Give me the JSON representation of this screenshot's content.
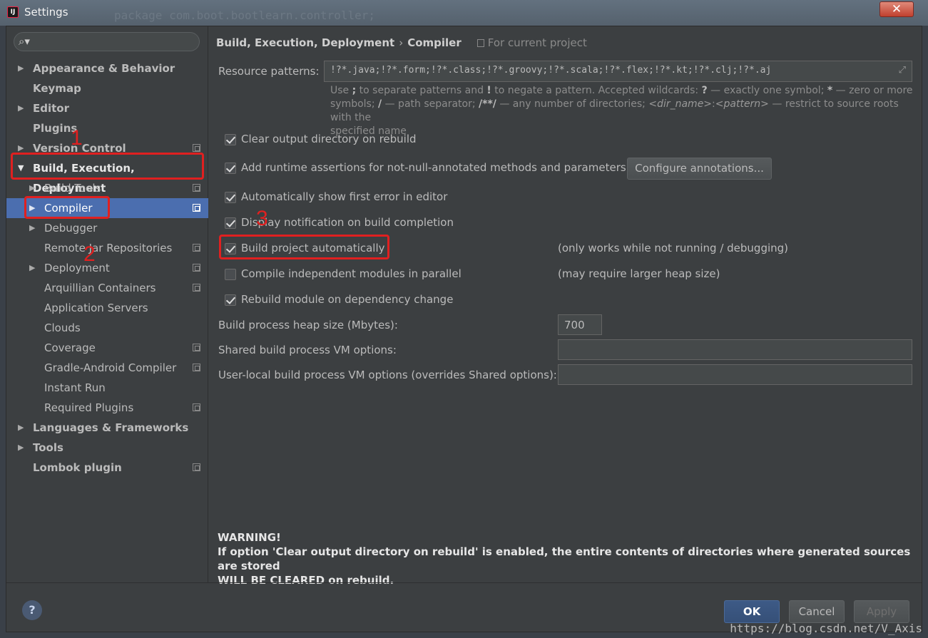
{
  "window": {
    "title": "Settings",
    "background_code": "package com.boot.bootlearn.controller;"
  },
  "search": {
    "placeholder": ""
  },
  "sidebar": {
    "items": [
      {
        "label": "Appearance & Behavior"
      },
      {
        "label": "Keymap"
      },
      {
        "label": "Editor"
      },
      {
        "label": "Plugins"
      },
      {
        "label": "Version Control"
      },
      {
        "label": "Build, Execution, Deployment"
      },
      {
        "label": "Build Tools"
      },
      {
        "label": "Compiler"
      },
      {
        "label": "Debugger"
      },
      {
        "label": "Remote Jar Repositories"
      },
      {
        "label": "Deployment"
      },
      {
        "label": "Arquillian Containers"
      },
      {
        "label": "Application Servers"
      },
      {
        "label": "Clouds"
      },
      {
        "label": "Coverage"
      },
      {
        "label": "Gradle-Android Compiler"
      },
      {
        "label": "Instant Run"
      },
      {
        "label": "Required Plugins"
      },
      {
        "label": "Languages & Frameworks"
      },
      {
        "label": "Tools"
      },
      {
        "label": "Lombok plugin"
      }
    ]
  },
  "annotations": {
    "n1": "1",
    "n2": "2",
    "n3": "3"
  },
  "breadcrumb": {
    "parent": "Build, Execution, Deployment",
    "sep": "›",
    "current": "Compiler",
    "note": "For current project"
  },
  "resource_patterns": {
    "label": "Resource patterns:",
    "value": "!?*.java;!?*.form;!?*.class;!?*.groovy;!?*.scala;!?*.flex;!?*.kt;!?*.clj;!?*.aj",
    "hint_1a": "Use ",
    "hint_1b": ";",
    "hint_1c": " to separate patterns and ",
    "hint_1d": "!",
    "hint_1e": " to negate a pattern. Accepted wildcards: ",
    "hint_1f": "?",
    "hint_1g": " — exactly one symbol; ",
    "hint_1h": "*",
    "hint_1i": " — zero or more",
    "hint_2a": "symbols; ",
    "hint_2b": "/",
    "hint_2c": " — path separator; ",
    "hint_2d": "/**/",
    "hint_2e": " — any number of directories; ",
    "hint_2f": "<dir_name>",
    "hint_2g": ":",
    "hint_2h": "<pattern>",
    "hint_2i": " — restrict to source roots with the",
    "hint_3": "specified name"
  },
  "options": {
    "clear_output": {
      "label": "Clear output directory on rebuild",
      "checked": true
    },
    "runtime_assertions": {
      "label": "Add runtime assertions for not-null-annotated methods and parameters",
      "checked": true
    },
    "configure_annotations": "Configure annotations...",
    "show_first_error": {
      "label": "Automatically show first error in editor",
      "checked": true
    },
    "display_notification": {
      "label": "Display notification on build completion",
      "checked": true
    },
    "build_auto": {
      "label": "Build project automatically",
      "checked": true,
      "note": "(only works while not running / debugging)"
    },
    "compile_parallel": {
      "label": "Compile independent modules in parallel",
      "checked": false,
      "note": "(may require larger heap size)"
    },
    "rebuild_dependency": {
      "label": "Rebuild module on dependency change",
      "checked": true
    }
  },
  "heap": {
    "label": "Build process heap size (Mbytes):",
    "value": "700"
  },
  "shared_vm": {
    "label": "Shared build process VM options:",
    "value": ""
  },
  "local_vm": {
    "label": "User-local build process VM options (overrides Shared options):",
    "value": ""
  },
  "warning": {
    "line1": "WARNING!",
    "line2": "If option 'Clear output directory on rebuild' is enabled, the entire contents of directories where generated sources are stored",
    "line3": "WILL BE CLEARED on rebuild."
  },
  "footer": {
    "help": "?",
    "ok": "OK",
    "cancel": "Cancel",
    "apply": "Apply"
  },
  "watermark": "https://blog.csdn.net/V_Axis"
}
